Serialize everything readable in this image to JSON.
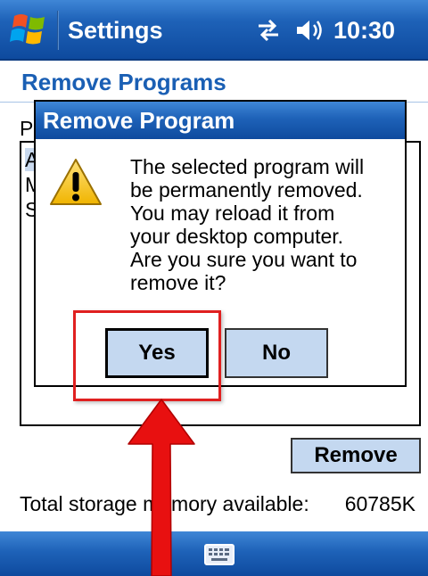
{
  "title_bar": {
    "app_title": "Settings",
    "clock": "10:30",
    "icons": [
      "windows-start-icon",
      "connectivity-icon",
      "volume-icon"
    ]
  },
  "page": {
    "heading": "Remove Programs",
    "list_label_peek": "P",
    "list_items_peek": [
      "A",
      "M",
      "S"
    ],
    "remove_button": "Remove",
    "storage_label": "Total storage memory available:",
    "storage_value": "60785K"
  },
  "dialog": {
    "title": "Remove Program",
    "message_lines": [
      "The selected program will",
      "be permanently removed.",
      "You may reload it from",
      "your desktop computer.",
      "Are you sure you want to",
      "remove it?"
    ],
    "yes_button": "Yes",
    "no_button": "No"
  },
  "menu_bar": {
    "icons": [
      "keyboard-icon"
    ]
  },
  "colors": {
    "bar_blue": "#1e62b8",
    "heading_blue": "#1a5fb4",
    "button_fill": "#c4d8f0",
    "annotation_red": "#e02020"
  }
}
